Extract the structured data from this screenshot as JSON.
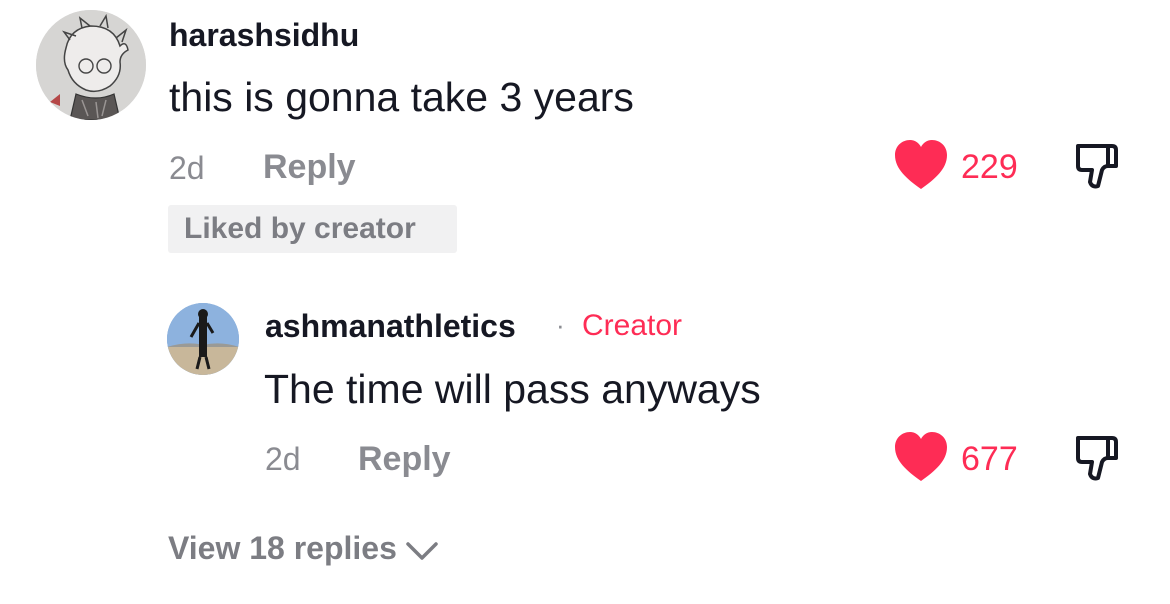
{
  "comments": [
    {
      "username": "harashsidhu",
      "text": "this is gonna take 3 years",
      "time": "2d",
      "reply_label": "Reply",
      "likes": "229",
      "liked_by_creator_label": "Liked by creator",
      "avatar_icon": "cartoon-drawing-avatar"
    },
    {
      "username": "ashmanathletics",
      "separator": "·",
      "badge": "Creator",
      "text": "The time will pass anyways",
      "time": "2d",
      "reply_label": "Reply",
      "likes": "677",
      "avatar_icon": "person-photo-avatar"
    }
  ],
  "view_replies_label": "View 18 replies",
  "icons": {
    "like": "heart-icon",
    "dislike": "thumbs-down-icon",
    "expand": "chevron-down-icon"
  },
  "colors": {
    "accent": "#fe2c55",
    "text_primary": "#161823",
    "text_secondary": "#8a8b91",
    "badge_bg": "#f1f1f2"
  }
}
